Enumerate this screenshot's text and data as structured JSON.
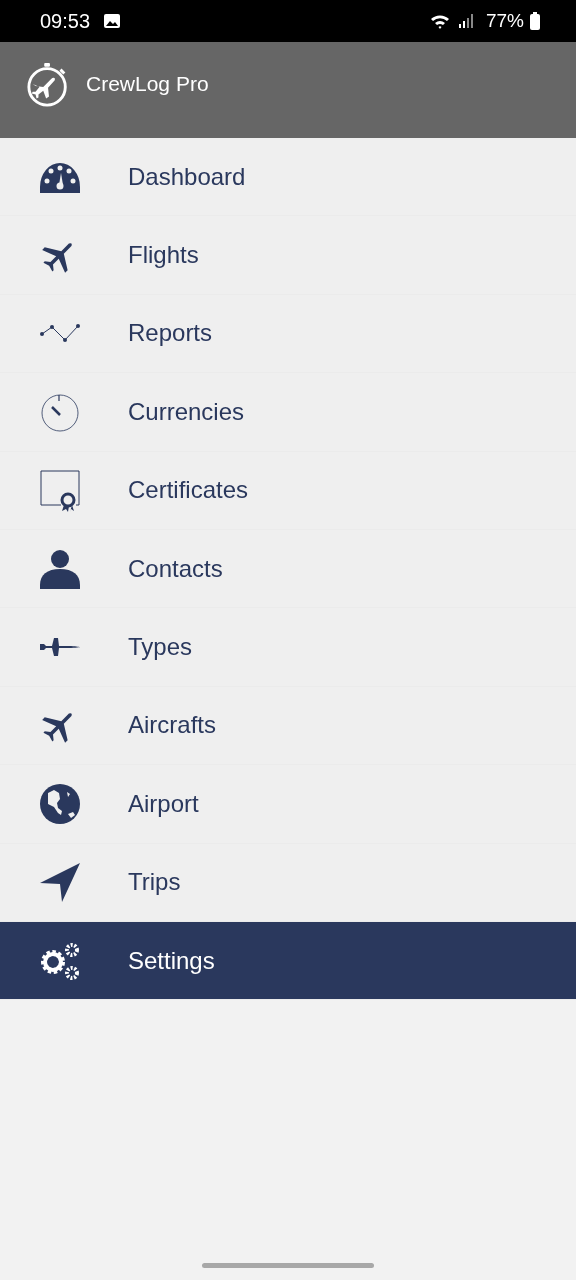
{
  "status_bar": {
    "time": "09:53",
    "battery": "77%"
  },
  "app_bar": {
    "title": "CrewLog Pro"
  },
  "menu": [
    {
      "label": "Dashboard",
      "kind": "gauge",
      "selected": false
    },
    {
      "label": "Flights",
      "kind": "plane",
      "selected": false
    },
    {
      "label": "Reports",
      "kind": "chart",
      "selected": false
    },
    {
      "label": "Currencies",
      "kind": "timer",
      "selected": false
    },
    {
      "label": "Certificates",
      "kind": "certificate",
      "selected": false
    },
    {
      "label": "Contacts",
      "kind": "person",
      "selected": false
    },
    {
      "label": "Types",
      "kind": "jet",
      "selected": false
    },
    {
      "label": "Aircrafts",
      "kind": "plane",
      "selected": false
    },
    {
      "label": "Airport",
      "kind": "globe",
      "selected": false
    },
    {
      "label": "Trips",
      "kind": "arrow",
      "selected": false
    },
    {
      "label": "Settings",
      "kind": "gears",
      "selected": true
    }
  ]
}
